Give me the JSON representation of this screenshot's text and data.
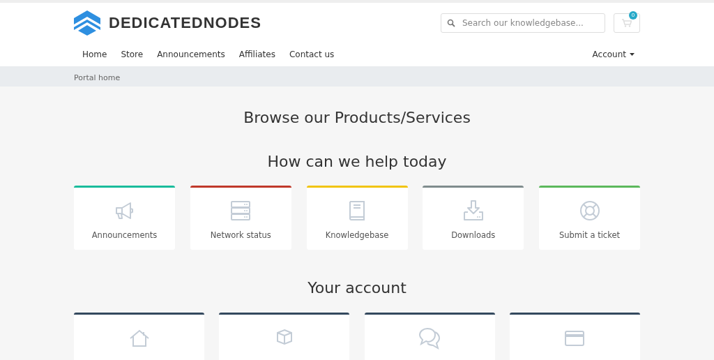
{
  "header": {
    "brand": "DEDICATEDNODES",
    "search": {
      "placeholder": "Search our knowledgebase..."
    },
    "cart": {
      "count": "0"
    }
  },
  "nav": {
    "items": [
      {
        "label": "Home"
      },
      {
        "label": "Store"
      },
      {
        "label": "Announcements"
      },
      {
        "label": "Affiliates"
      },
      {
        "label": "Contact us"
      }
    ],
    "account": "Account"
  },
  "breadcrumb": [
    "Portal home"
  ],
  "headings": {
    "browse": "Browse our Products/Services",
    "help": "How can we help today",
    "account": "Your account"
  },
  "help_cards": [
    {
      "label": "Announcements",
      "color": "#1abc9c"
    },
    {
      "label": "Network status",
      "color": "#c0392b"
    },
    {
      "label": "Knowledgebase",
      "color": "#f1c40f"
    },
    {
      "label": "Downloads",
      "color": "#7f8c8d"
    },
    {
      "label": "Submit a ticket",
      "color": "#5cb85c"
    }
  ],
  "account_cards": [
    {
      "color": "#34495e"
    },
    {
      "color": "#34495e"
    },
    {
      "color": "#34495e"
    },
    {
      "color": "#34495e"
    }
  ]
}
